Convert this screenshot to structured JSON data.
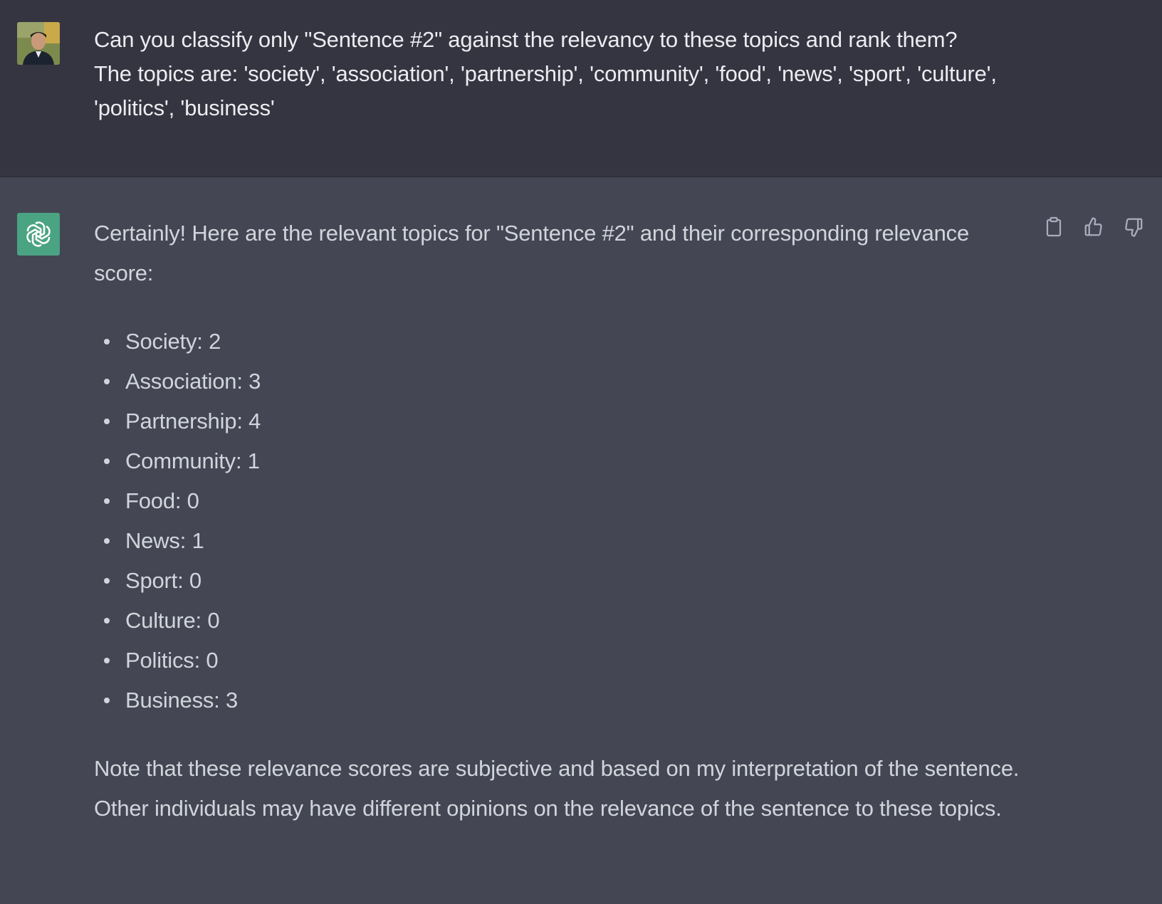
{
  "conversation": {
    "user_message": {
      "lines": [
        "Can you classify only \"Sentence #2\" against the relevancy to these topics and rank them?",
        "The topics are: 'society', 'association', 'partnership', 'community', 'food', 'news', 'sport', 'culture', 'politics', 'business'"
      ]
    },
    "assistant_message": {
      "intro": "Certainly! Here are the relevant topics for \"Sentence #2\" and their corresponding relevance score:",
      "scores": [
        {
          "label": "Society: 2"
        },
        {
          "label": "Association: 3"
        },
        {
          "label": "Partnership: 4"
        },
        {
          "label": "Community: 1"
        },
        {
          "label": "Food: 0"
        },
        {
          "label": "News: 1"
        },
        {
          "label": "Sport: 0"
        },
        {
          "label": "Culture: 0"
        },
        {
          "label": "Politics: 0"
        },
        {
          "label": "Business: 3"
        }
      ],
      "note": "Note that these relevance scores are subjective and based on my interpretation of the sentence. Other individuals may have different opinions on the relevance of the sentence to these topics."
    },
    "actions": [
      "copy-icon",
      "thumbs-up-icon",
      "thumbs-down-icon"
    ]
  },
  "colors": {
    "user_bg": "#343541",
    "assistant_bg": "#444654",
    "bot_avatar": "#4aa382",
    "text_user": "#ececf1",
    "text_assistant": "#d1d5db"
  }
}
